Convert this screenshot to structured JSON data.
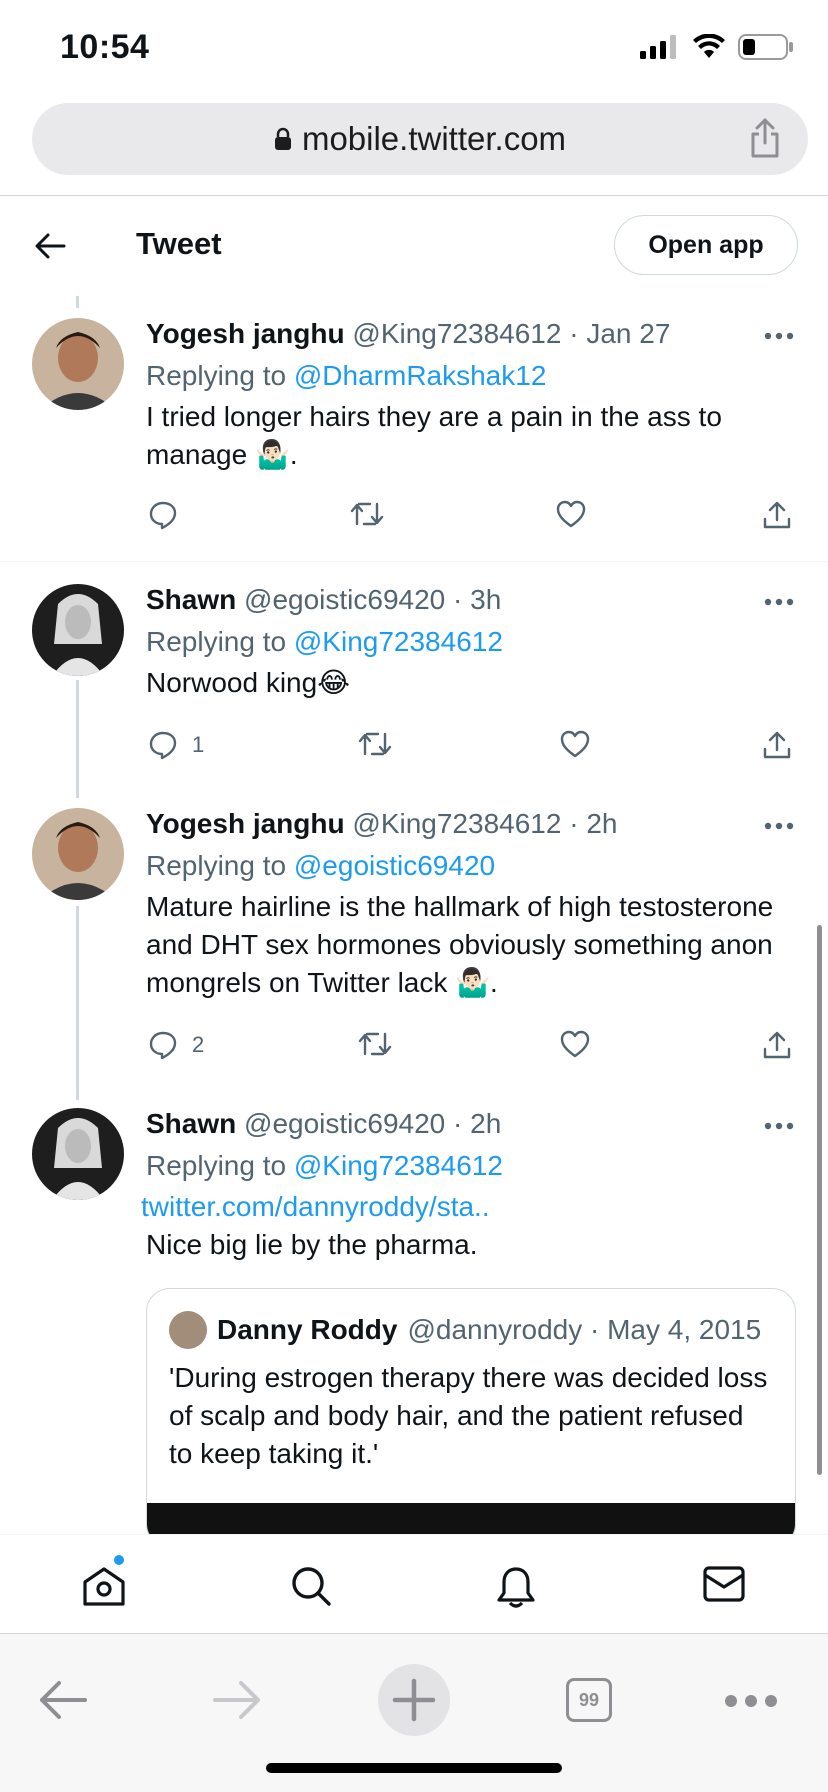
{
  "status": {
    "time": "10:54"
  },
  "browser": {
    "url": "mobile.twitter.com",
    "tab_count": "99"
  },
  "header": {
    "title": "Tweet",
    "open_app_label": "Open app"
  },
  "tweets": [
    {
      "name": "Yogesh janghu",
      "meta": "@King72384612 · Jan 27",
      "replying_prefix": "Replying to ",
      "replying_to": "@DharmRakshak12",
      "body": "I tried longer hairs they are a pain in the ass to manage 🤷🏻‍♂️.",
      "replies": "",
      "avatar_color": "#6d5343"
    },
    {
      "name": "Shawn",
      "meta": "@egoistic69420 · 3h",
      "replying_prefix": "Replying to ",
      "replying_to": "@King72384612",
      "body": "Norwood king😂",
      "replies": "1",
      "avatar_color": "#2b2b2b"
    },
    {
      "name": "Yogesh janghu",
      "meta": "@King72384612 · 2h",
      "replying_prefix": "Replying to ",
      "replying_to": "@egoistic69420",
      "body": "Mature hairline is the hallmark of high testosterone and DHT sex hormones obviously something anon mongrels on Twitter lack 🤷🏻‍♂️.",
      "replies": "2",
      "avatar_color": "#6d5343"
    },
    {
      "name": "Shawn",
      "meta": "@egoistic69420 · 2h",
      "replying_prefix": "Replying to ",
      "replying_to": "@King72384612",
      "link": "twitter.com/dannyroddy/sta..",
      "body": "Nice big lie by the pharma.",
      "avatar_color": "#2b2b2b"
    }
  ],
  "quote": {
    "name": "Danny Roddy",
    "meta": "@dannyroddy · May 4, 2015",
    "text": "'During estrogen therapy there was decided loss of scalp and body hair, and the patient refused to keep taking it.'"
  },
  "colors": {
    "accent": "#1d9bf0",
    "secondary_text": "#536471"
  }
}
